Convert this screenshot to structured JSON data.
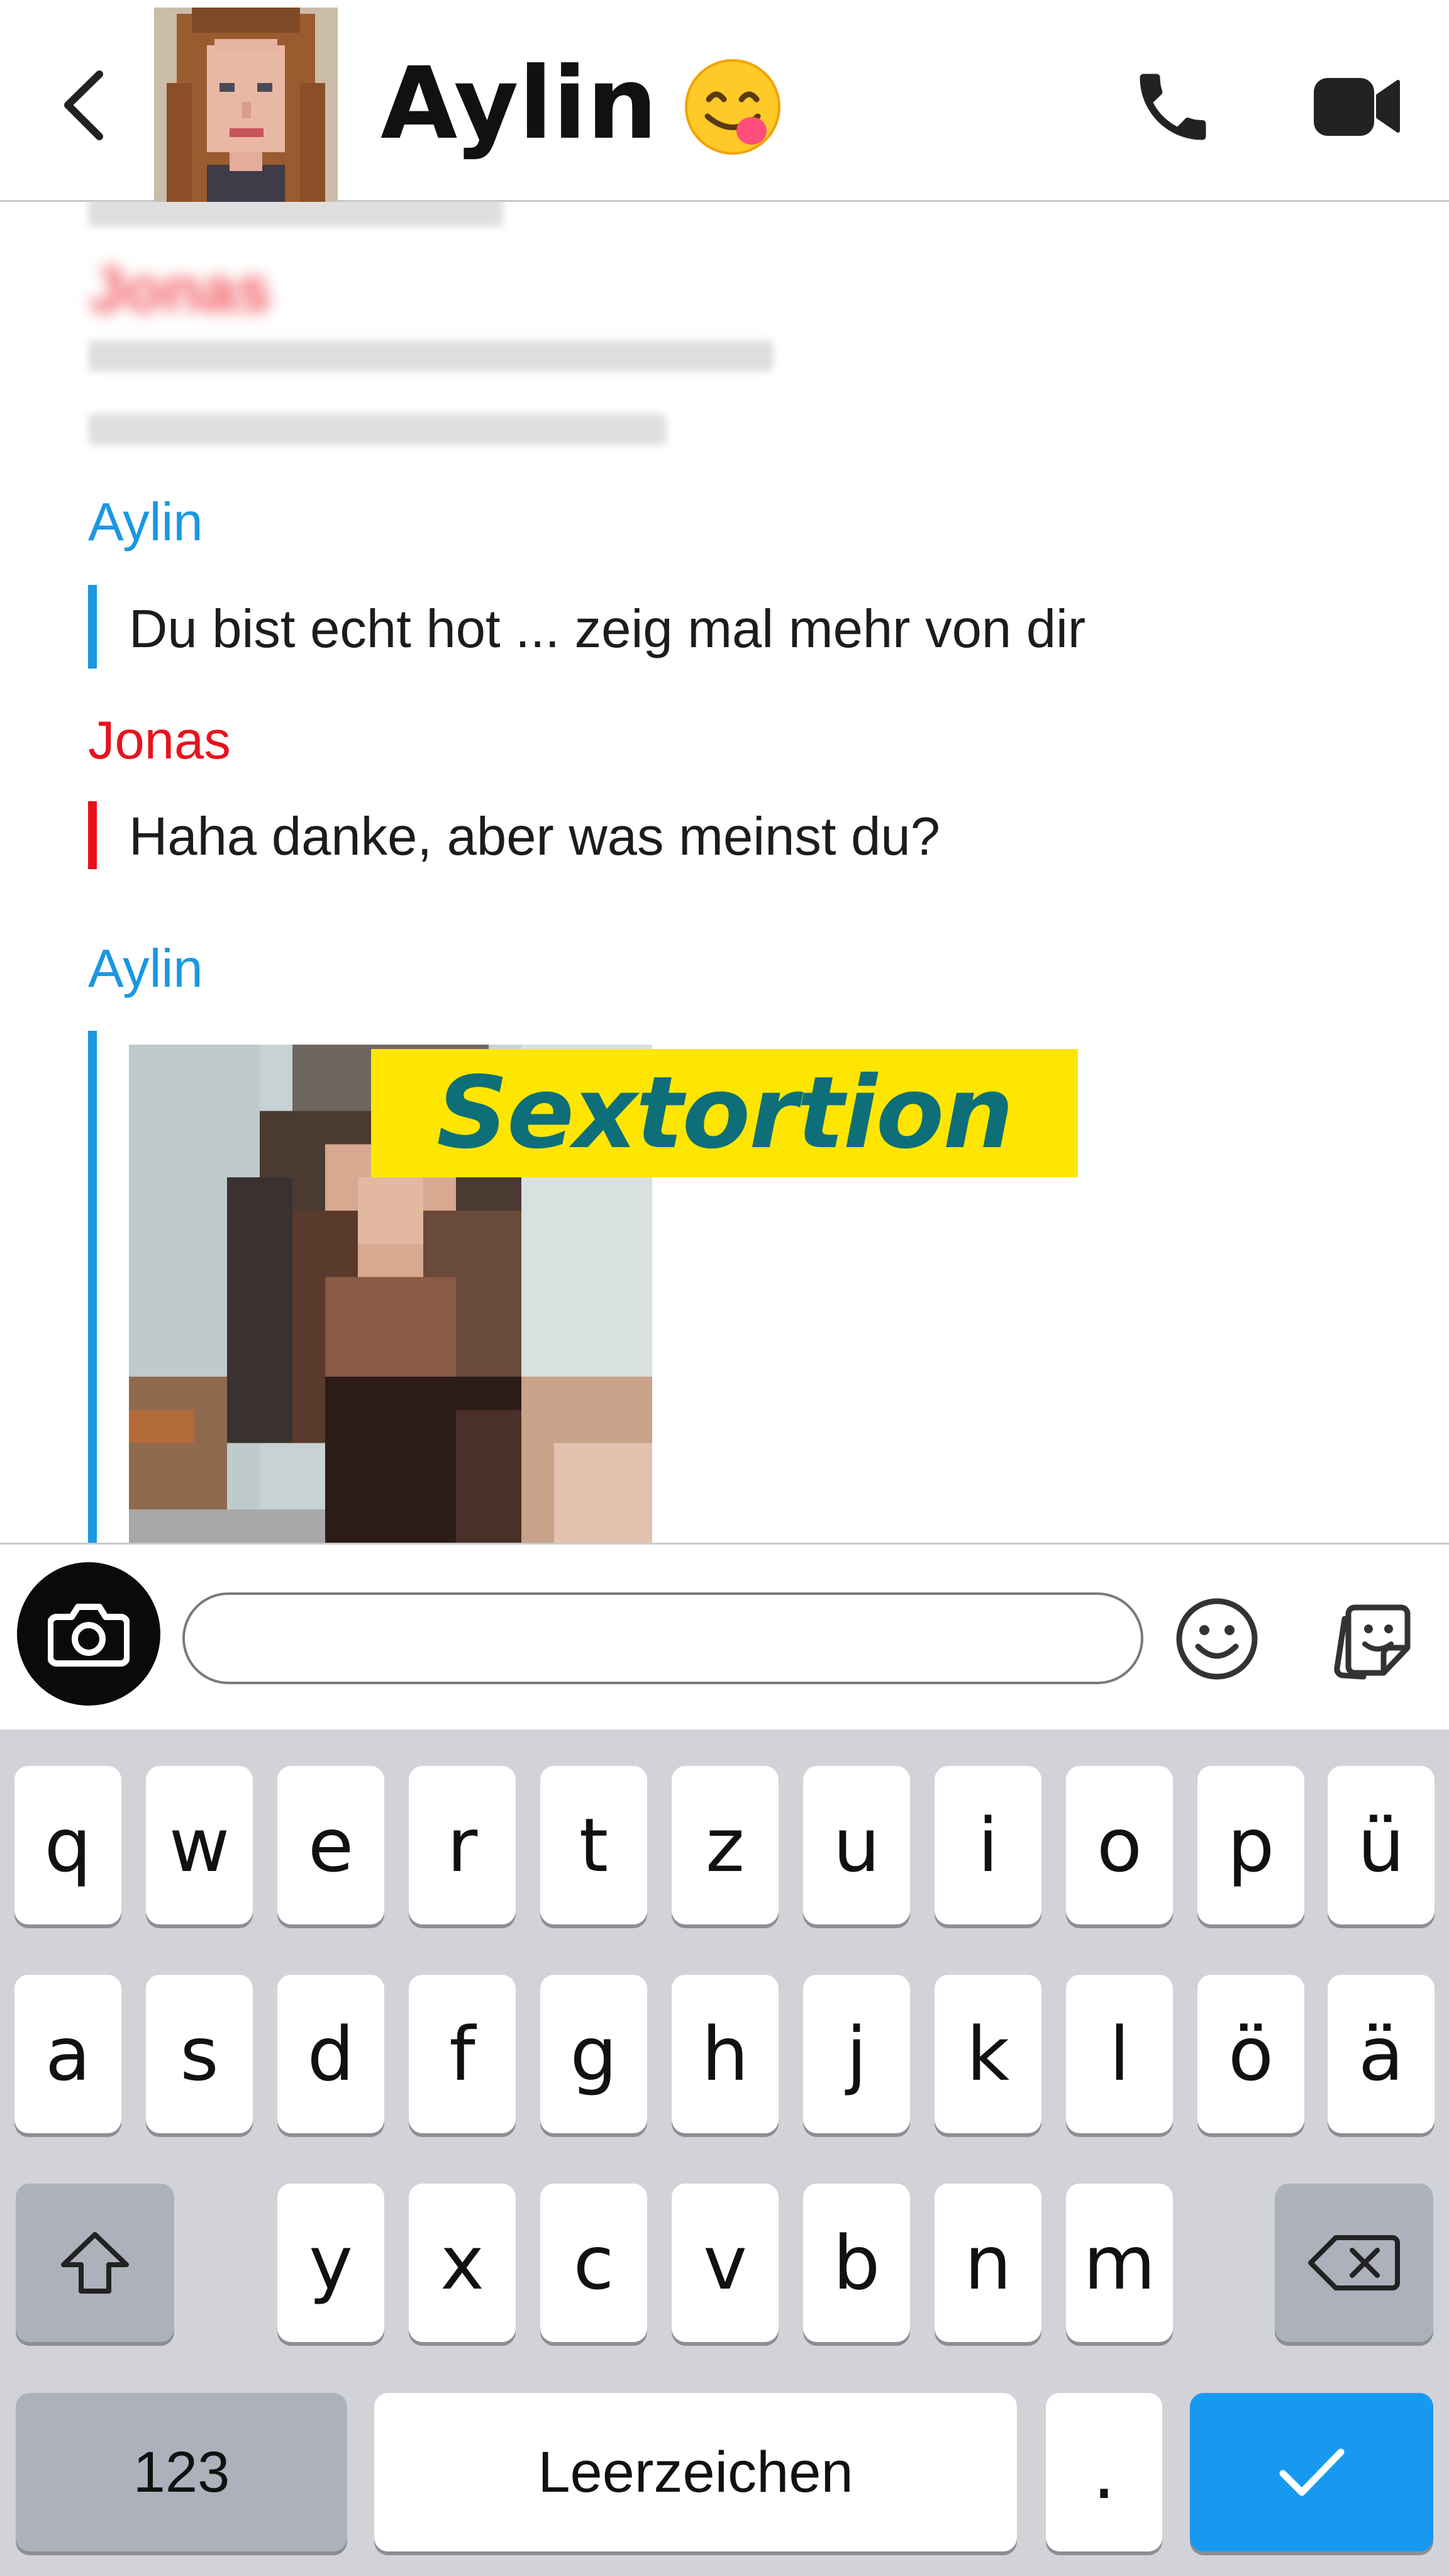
{
  "header": {
    "contact_name": "Aylin",
    "contact_emoji": "😋",
    "back_icon": "chevron-left-icon",
    "call_icon": "phone-icon",
    "video_icon": "video-camera-icon"
  },
  "chat": {
    "messages": [
      {
        "sender": "Aylin",
        "text": "Du bist echt hot ... zeig mal mehr von dir"
      },
      {
        "sender": "Jonas",
        "text": "Haha danke, aber was meinst du?"
      },
      {
        "sender": "Aylin",
        "text": ""
      }
    ],
    "blurred_sender": "Jonas",
    "overlay_label": "Sextortion"
  },
  "input_bar": {
    "camera_icon": "camera-icon",
    "message_value": "",
    "emoji_icon": "smiley-icon",
    "sticker_icon": "sticker-icon"
  },
  "keyboard": {
    "row1": [
      "q",
      "w",
      "e",
      "r",
      "t",
      "z",
      "u",
      "i",
      "o",
      "p",
      "ü"
    ],
    "row2": [
      "a",
      "s",
      "d",
      "f",
      "g",
      "h",
      "j",
      "k",
      "l",
      "ö",
      "ä"
    ],
    "row3": [
      "y",
      "x",
      "c",
      "v",
      "b",
      "n",
      "m"
    ],
    "numbers_label": "123",
    "space_label": "Leerzeichen",
    "period_label": ".",
    "shift_icon": "shift-arrow-icon",
    "backspace_icon": "backspace-icon",
    "confirm_icon": "checkmark-icon"
  },
  "colors": {
    "aylin": "#1b97e2",
    "jonas": "#e8121d",
    "label_background": "#ffe600",
    "label_text": "#0e6f78",
    "confirm_key": "#1799f0",
    "keyboard_background": "#d1d3d9"
  }
}
